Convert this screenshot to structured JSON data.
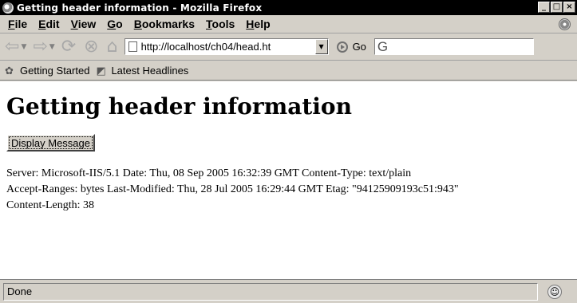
{
  "window": {
    "title": "Getting header information - Mozilla Firefox",
    "controls": {
      "minimize": "_",
      "maximize": "□",
      "close": "×"
    }
  },
  "menu": {
    "items": [
      {
        "accel": "F",
        "rest": "ile"
      },
      {
        "accel": "E",
        "rest": "dit"
      },
      {
        "accel": "V",
        "rest": "iew"
      },
      {
        "accel": "G",
        "rest": "o"
      },
      {
        "accel": "B",
        "rest": "ookmarks"
      },
      {
        "accel": "T",
        "rest": "ools"
      },
      {
        "accel": "H",
        "rest": "elp"
      }
    ]
  },
  "navigation": {
    "back_icon": "back-arrow-icon",
    "forward_icon": "forward-arrow-icon",
    "reload_icon": "reload-icon",
    "stop_icon": "stop-icon",
    "home_icon": "home-icon",
    "url": "http://localhost/ch04/head.ht",
    "go_label": "Go",
    "search_engine_icon": "G"
  },
  "bookmarks": {
    "items": [
      {
        "label": "Getting Started",
        "icon": "firefox-icon"
      },
      {
        "label": "Latest Headlines",
        "icon": "rss-icon"
      }
    ]
  },
  "page": {
    "heading": "Getting header information",
    "button_label": "Display Message",
    "output_lines": [
      "Server: Microsoft-IIS/5.1 Date: Thu, 08 Sep 2005 16:32:39 GMT Content-Type: text/plain",
      "Accept-Ranges: bytes Last-Modified: Thu, 28 Jul 2005 16:29:44 GMT Etag: \"94125909193c51:943\"",
      "Content-Length: 38"
    ]
  },
  "status": {
    "text": "Done"
  }
}
